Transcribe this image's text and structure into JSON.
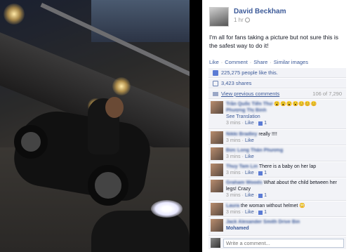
{
  "post": {
    "author": "David Beckham",
    "time": "1 hr",
    "text": "I'm all for fans taking a picture but not sure this is the safest way to do it!",
    "actions": [
      "Like",
      "Comment",
      "Share",
      "Similar images"
    ],
    "likes": "225,275 people like this.",
    "shares": "3,423 shares",
    "view_previous": "View previous comments",
    "comment_count": "106 of 7,290"
  },
  "comments": [
    {
      "name": "Trần Quốc Tiến Thư",
      "text": "😮😮😮😮😊😊😊",
      "extra": "Phượng Thị Bình",
      "translation": "See Translation",
      "time": "3 mins",
      "like": "Like",
      "likes": "1"
    },
    {
      "name": "Nikki Bradley",
      "text": "really !!!!",
      "time": "3 mins",
      "like": "Like",
      "likes": ""
    },
    {
      "name": "Đức Long Thân Phương",
      "text": "",
      "time": "3 mins",
      "like": "Like",
      "likes": ""
    },
    {
      "name": "Thuy Tam Lin",
      "text": "There is a baby on her lap",
      "time": "3 mins",
      "like": "Like",
      "likes": "1"
    },
    {
      "name": "Graham Woods",
      "text": "What about the child between her legs! Crazy",
      "time": "3 mins",
      "like": "Like",
      "likes": "1"
    },
    {
      "name": "Laura",
      "text": "the woman without helmet 😳",
      "time": "3 mins",
      "like": "Like",
      "likes": "1"
    },
    {
      "name": "Jack Alexander Smith Drive Bin",
      "text": "Mohamed",
      "time": "",
      "like": "",
      "likes": ""
    }
  ],
  "write_placeholder": "Write a comment..."
}
